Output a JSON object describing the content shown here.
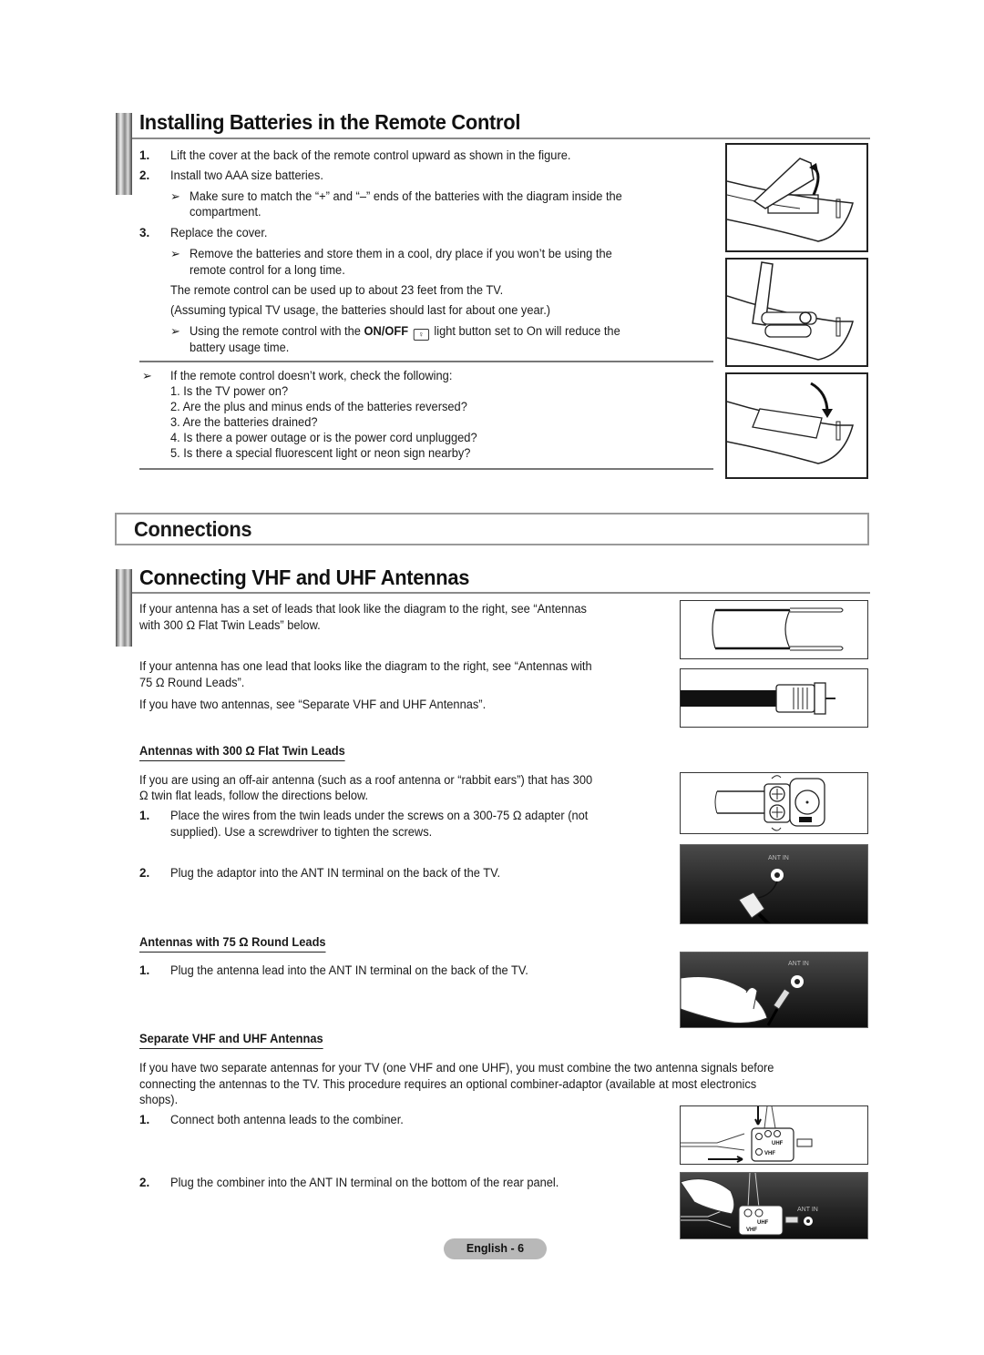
{
  "section1": {
    "title": "Installing Batteries in the Remote Control",
    "steps": [
      {
        "num": "1.",
        "text": "Lift the cover at the back of the remote control upward as shown in the figure."
      },
      {
        "num": "2.",
        "text": "Install two AAA size batteries."
      },
      {
        "num": "3.",
        "text": "Replace the cover."
      }
    ],
    "note_match": [
      "Make sure to match the “+” and “–” ends of the batteries with the diagram inside the",
      "compartment."
    ],
    "note_remove": [
      "Remove the batteries and store them in a cool, dry place if you won’t be using the",
      "remote control for a long time."
    ],
    "range_text": "The remote control can be used up to about 23 feet from the TV.",
    "life_text": "(Assuming typical TV usage, the batteries should last for about one year.)",
    "note_light": {
      "before": "Using the remote control with the",
      "bold": "ON/OFF",
      "icon": "light-bulb-icon",
      "after": "light button set to On will reduce the",
      "line2": "battery usage time."
    },
    "troubleshoot": {
      "intro": "If the remote control doesn’t work, check the following:",
      "items": [
        "1. Is the TV power on?",
        "2. Are the plus and minus ends of the batteries reversed?",
        "3. Are the batteries drained?",
        "4. Is there a power outage or is the power cord unplugged?",
        "5. Is there a special fluorescent light or neon sign nearby?"
      ]
    },
    "figures": [
      "remote-cover-open-figure",
      "remote-batteries-inserted-figure",
      "remote-cover-closing-figure"
    ]
  },
  "connections": {
    "title": "Connections"
  },
  "section2": {
    "title": "Connecting VHF and UHF Antennas",
    "intro1": [
      "If your antenna has a set of leads that look like the diagram to the right, see “Antennas",
      "with 300 Ω Flat Twin Leads” below."
    ],
    "intro2": [
      "If your antenna has one lead that looks like the diagram to the right, see “Antennas with",
      "75 Ω Round Leads”."
    ],
    "intro3": "If you have two antennas, see “Separate VHF and UHF Antennas”.",
    "flat_twin": {
      "heading": "Antennas with 300 Ω Flat Twin Leads",
      "desc": [
        "If you are using an off-air antenna (such as a roof antenna or “rabbit ears”) that has 300",
        "Ω twin flat leads, follow the directions below."
      ],
      "steps": [
        {
          "num": "1.",
          "lines": [
            "Place the wires from the twin leads under the screws on a 300-75 Ω adapter (not",
            "supplied). Use a screwdriver to tighten the screws."
          ]
        },
        {
          "num": "2.",
          "lines": [
            "Plug the adaptor into the ANT IN terminal on the back of the TV."
          ]
        }
      ]
    },
    "round": {
      "heading": "Antennas with 75 Ω Round Leads",
      "steps": [
        {
          "num": "1.",
          "lines": [
            "Plug the antenna lead into the ANT IN terminal on the back of the TV."
          ]
        }
      ]
    },
    "separate": {
      "heading": "Separate VHF and UHF Antennas",
      "desc": [
        "If you have two separate antennas for your TV (one VHF and one UHF), you must combine the two antenna signals before",
        "connecting the antennas to the TV. This procedure requires an optional combiner-adaptor (available at most electronics",
        "shops)."
      ],
      "steps": [
        {
          "num": "1.",
          "lines": [
            "Connect both antenna leads to the combiner."
          ]
        },
        {
          "num": "2.",
          "lines": [
            "Plug the combiner into the ANT IN terminal on the bottom of the rear panel."
          ]
        }
      ]
    },
    "figure_labels": {
      "ant_in": "ANT IN",
      "uhf": "UHF",
      "vhf": "VHF"
    }
  },
  "footer": {
    "page_label": "English - 6"
  }
}
